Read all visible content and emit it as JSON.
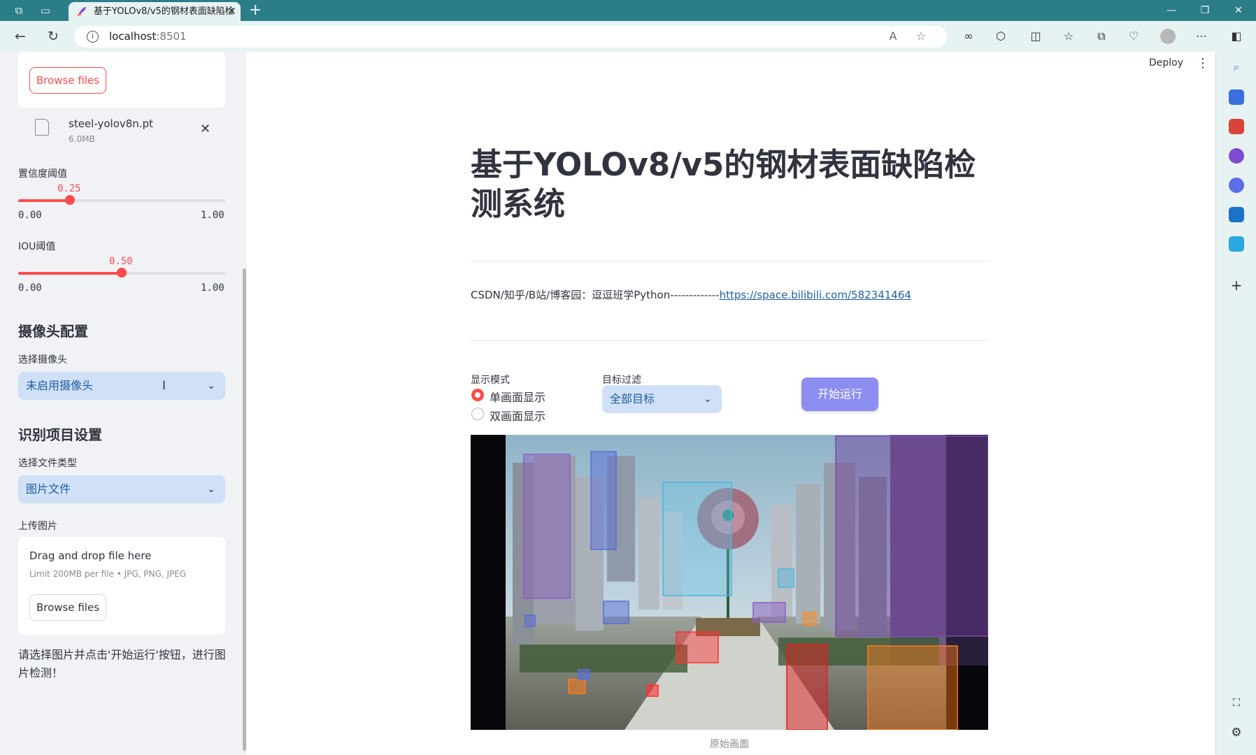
{
  "browser": {
    "tab_title": "基于YOLOv8/v5的钢材表面缺陷检",
    "url_host": "localhost",
    "url_port": ":8501",
    "colors": {
      "chrome": "#2b7d87",
      "toolbar": "#e7f2f3"
    }
  },
  "app": {
    "deploy_label": "Deploy",
    "title": "基于YOLOv8/v5的钢材表面缺陷检测系统",
    "credit_text": "CSDN/知乎/B站/博客园：逗逗班学Python-------------",
    "credit_link": "https://space.bilibili.com/582341464",
    "display_mode_label": "显示模式",
    "display_modes": [
      "单画面显示",
      "双画面显示"
    ],
    "selected_display_mode": "单画面显示",
    "filter_label": "目标过滤",
    "filter_value": "全部目标",
    "run_label": "开始运行",
    "image_caption": "原始画面",
    "accent_color": "#ff4b4b",
    "run_button_color": "#8c8ef2"
  },
  "sidebar": {
    "model_browse_label": "Browse files",
    "model_file": {
      "name": "steel-yolov8n.pt",
      "size": "6.0MB"
    },
    "confidence": {
      "label": "置信度阈值",
      "value": "0.25",
      "min": "0.00",
      "max": "1.00",
      "fraction": 0.25
    },
    "iou": {
      "label": "IOU阈值",
      "value": "0.50",
      "min": "0.00",
      "max": "1.00",
      "fraction": 0.5
    },
    "camera_header": "摄像头配置",
    "camera_select_label": "选择摄像头",
    "camera_select_value": "未启用摄像头",
    "recog_header": "识别项目设置",
    "filetype_label": "选择文件类型",
    "filetype_value": "图片文件",
    "upload_label": "上传图片",
    "drop_text": "Drag and drop file here",
    "limit_text": "Limit 200MB per file • JPG, PNG, JPEG",
    "upload_browse_label": "Browse files",
    "hint": "请选择图片并点击'开始运行'按钮，进行图片检测！"
  }
}
